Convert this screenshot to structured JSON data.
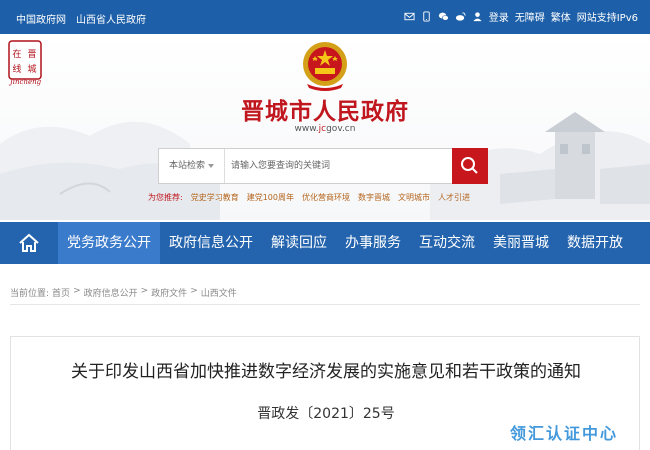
{
  "topbar": {
    "links_left": [
      "中国政府网",
      "山西省人民政府"
    ],
    "links_right": [
      "登录",
      "无障碍",
      "繁体",
      "网站支持IPv6"
    ],
    "icons": [
      "mail-icon",
      "mobile-icon",
      "wechat-icon",
      "weibo-icon",
      "user-icon"
    ]
  },
  "header": {
    "logo_text": "Jincheng",
    "logo_chars": [
      "在",
      "晋",
      "线",
      "城"
    ],
    "title": "晋城市人民政府",
    "domain_prefix": "www.",
    "domain_highlight": "jc",
    "domain_suffix": "gov.cn"
  },
  "search": {
    "scope_label": "本站检索",
    "placeholder": "请输入您要查询的关键词"
  },
  "recommend": {
    "label": "为您推荐:",
    "items": [
      "党史学习教育",
      "建党100周年",
      "优化营商环境",
      "数字晋城",
      "文明城市",
      "人才引进"
    ]
  },
  "nav": {
    "items": [
      "党务政务公开",
      "政府信息公开",
      "解读回应",
      "办事服务",
      "互动交流",
      "美丽晋城",
      "数据开放"
    ]
  },
  "breadcrumb": {
    "label": "当前位置:",
    "items": [
      "首页",
      "政府信息公开",
      "政府文件",
      "山西文件"
    ],
    "separator": ">"
  },
  "article": {
    "title": "关于印发山西省加快推进数字经济发展的实施意见和若干政策的通知",
    "doc_number": "晋政发〔2021〕25号"
  },
  "watermark": "领汇认证中心",
  "colors": {
    "primary_blue": "#1d5fa8",
    "nav_blue": "#2464ae",
    "nav_active": "#3b7bcb",
    "brand_red": "#c0161e"
  }
}
